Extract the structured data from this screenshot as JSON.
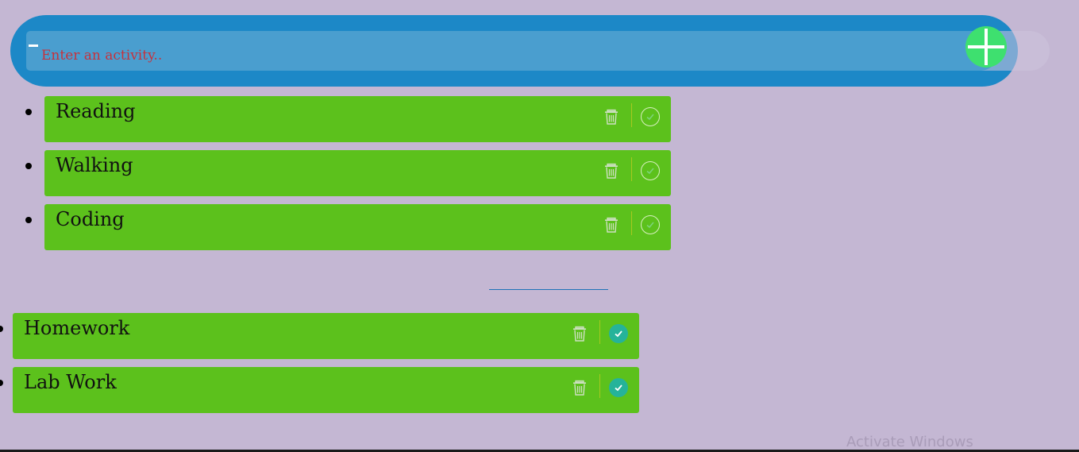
{
  "header": {
    "input_placeholder": "Enter an activity..",
    "input_value": "",
    "add_button_icon": "plus-icon"
  },
  "todo": {
    "items": [
      {
        "label": "Reading",
        "completed": false
      },
      {
        "label": "Walking",
        "completed": false
      },
      {
        "label": "Coding",
        "completed": false
      }
    ]
  },
  "completed": {
    "items": [
      {
        "label": "Homework",
        "completed": true
      },
      {
        "label": "Lab Work",
        "completed": true
      }
    ]
  },
  "icons": {
    "delete": "trash-icon",
    "complete": "checkmark-icon"
  },
  "colors": {
    "background": "#c4b7d3",
    "header": "#1c88c7",
    "input": "#4a9ecf",
    "placeholder": "#c7323c",
    "add_button": "#3ee06f",
    "item": "#5cc11c",
    "check_filled": "#25b39a"
  },
  "watermark": "Activate Windows"
}
